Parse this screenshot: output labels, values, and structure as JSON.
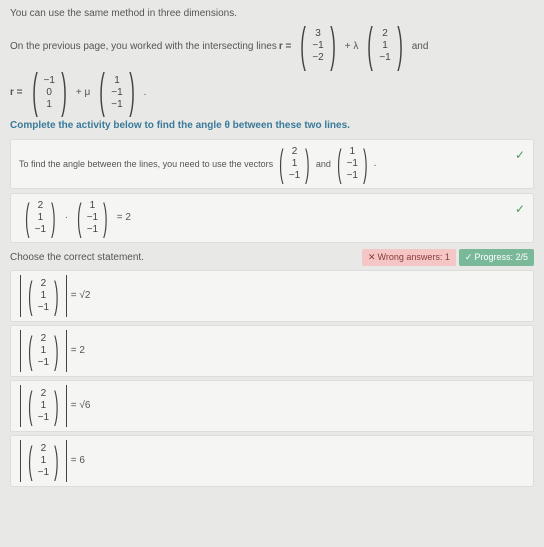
{
  "intro": "You can use the same method in three dimensions.",
  "prev_page": "On the previous page, you worked with the intersecting lines ",
  "r_eq": "r =",
  "and": "and",
  "plus_lambda": "+ λ",
  "plus_mu": "+ μ",
  "dot_end": ".",
  "v1": {
    "a": "3",
    "b": "−1",
    "c": "−2"
  },
  "v2": {
    "a": "2",
    "b": "1",
    "c": "−1"
  },
  "v3": {
    "a": "−1",
    "b": "0",
    "c": "1"
  },
  "v4": {
    "a": "1",
    "b": "−1",
    "c": "−1"
  },
  "complete": "Complete the activity below to find the angle θ between these two lines.",
  "find_angle": "To find the angle between the lines, you need to use the vectors",
  "vA": {
    "a": "2",
    "b": "1",
    "c": "−1"
  },
  "vB": {
    "a": "1",
    "b": "−1",
    "c": "−1"
  },
  "and2": "and",
  "dot_sym": "·",
  "eq2": "= 2",
  "choose": "Choose the correct statement.",
  "wrong_label": "Wrong answers: 1",
  "progress_label": "Progress: 2/5",
  "opt1": "= √2",
  "opt2": "= 2",
  "opt3": "= √6",
  "opt4": "= 6",
  "x_mark": "✕",
  "check": "✓"
}
